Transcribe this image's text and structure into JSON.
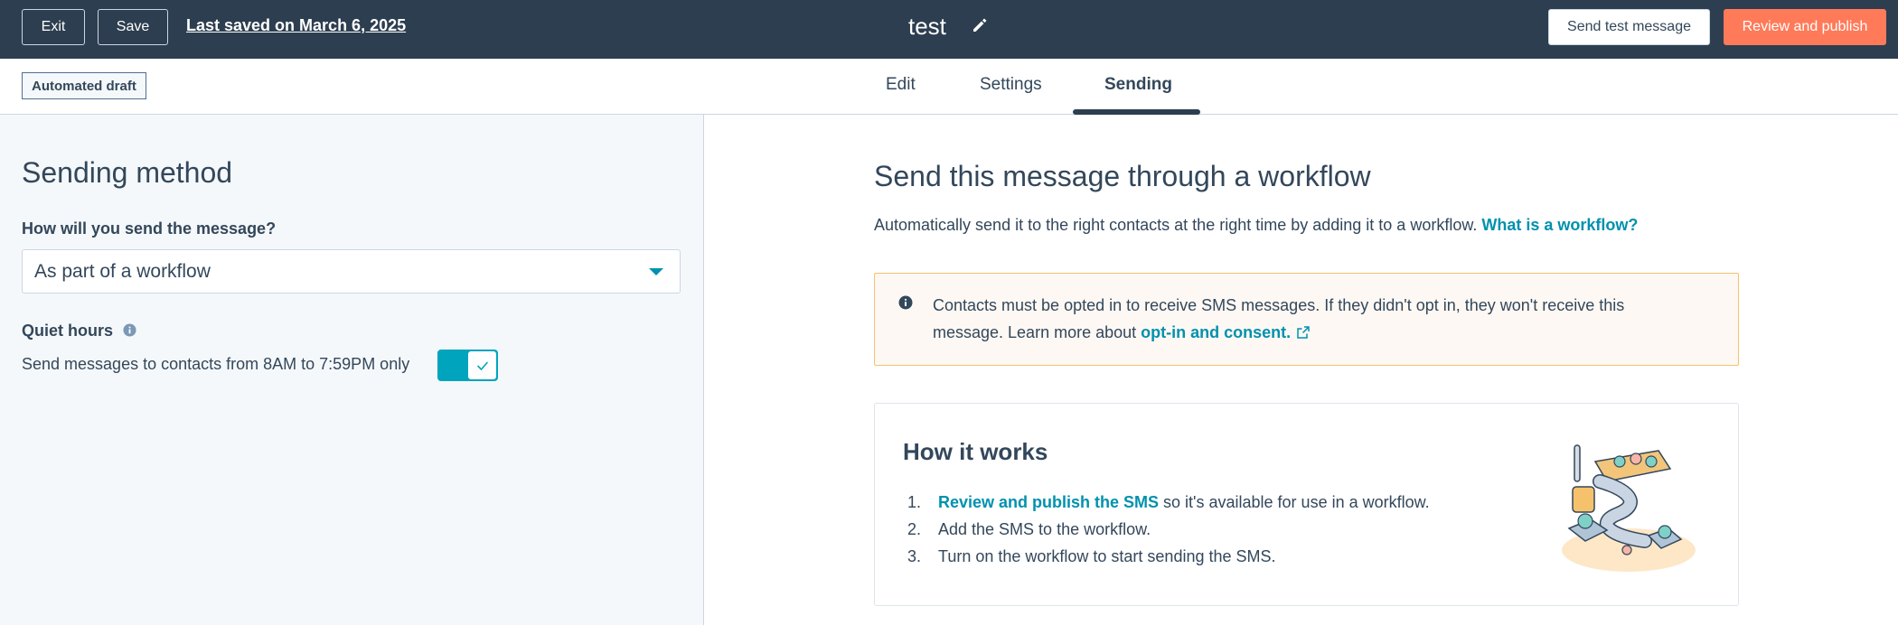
{
  "topbar": {
    "exit_label": "Exit",
    "save_label": "Save",
    "last_saved": "Last saved on March 6, 2025",
    "title": "test",
    "send_test_label": "Send test message",
    "publish_label": "Review and publish"
  },
  "subbar": {
    "badge": "Automated draft",
    "tabs": [
      {
        "label": "Edit",
        "active": false
      },
      {
        "label": "Settings",
        "active": false
      },
      {
        "label": "Sending",
        "active": true
      }
    ]
  },
  "left": {
    "heading": "Sending method",
    "field_label": "How will you send the message?",
    "selected_option": "As part of a workflow",
    "quiet_hours_label": "Quiet hours",
    "quiet_hours_desc": "Send messages to contacts from 8AM to 7:59PM only",
    "quiet_hours_enabled": true
  },
  "right": {
    "heading": "Send this message through a workflow",
    "desc": "Automatically send it to the right contacts at the right time by adding it to a workflow.",
    "desc_link": "What is a workflow?",
    "alert_text": "Contacts must be opted in to receive SMS messages. If they didn't opt in, they won't receive this message. Learn more about",
    "alert_link": "opt-in and consent.",
    "card_heading": "How it works",
    "steps": [
      {
        "num": "1.",
        "link": "Review and publish the SMS",
        "text": " so it's available for use in a workflow."
      },
      {
        "num": "2.",
        "text": "Add the SMS to the workflow."
      },
      {
        "num": "3.",
        "text": "Turn on the workflow to start sending the SMS."
      }
    ]
  },
  "colors": {
    "topbar": "#2d3e50",
    "accent": "#ff7a59",
    "link": "#0091ae",
    "toggle": "#00a4bd",
    "alert_border": "#f5c26b"
  }
}
